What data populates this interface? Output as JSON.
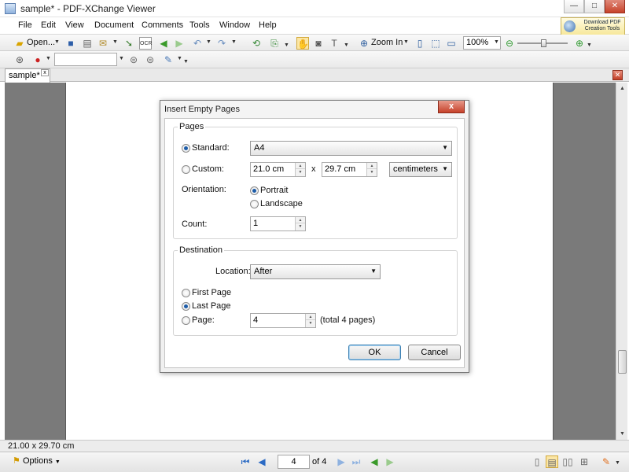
{
  "window": {
    "title": "sample* - PDF-XChange Viewer",
    "minimize_glyph": "—",
    "maximize_glyph": "□",
    "close_glyph": "✕"
  },
  "menu": {
    "items": [
      "File",
      "Edit",
      "View",
      "Document",
      "Comments",
      "Tools",
      "Window",
      "Help"
    ]
  },
  "ad_banner": {
    "line1": "Download PDF",
    "line2": "Creation Tools"
  },
  "toolbar": {
    "open_label": "Open...",
    "zoom_in_label": "Zoom In",
    "zoom_value": "100%",
    "ocr_label": "OCR"
  },
  "tab": {
    "label": "sample*",
    "close_glyph": "x"
  },
  "dialog": {
    "title": "Insert Empty Pages",
    "close_glyph": "x",
    "pages_group": {
      "title": "Pages",
      "standard_label": "Standard:",
      "standard_value": "A4",
      "custom_label": "Custom:",
      "width_value": "21.0 cm",
      "times": "x",
      "height_value": "29.7 cm",
      "unit_value": "centimeters",
      "orientation_label": "Orientation:",
      "portrait_label": "Portrait",
      "landscape_label": "Landscape",
      "count_label": "Count:",
      "count_value": "1"
    },
    "destination_group": {
      "title": "Destination",
      "location_label": "Location:",
      "location_value": "After",
      "first_page_label": "First Page",
      "last_page_label": "Last Page",
      "page_label": "Page:",
      "page_value": "4",
      "total_text": "(total 4 pages)"
    },
    "ok_label": "OK",
    "cancel_label": "Cancel"
  },
  "status": {
    "page_size": "21.00 x 29.70 cm"
  },
  "bottom": {
    "options_label": "Options",
    "current_page": "4",
    "of_text": "of 4"
  }
}
